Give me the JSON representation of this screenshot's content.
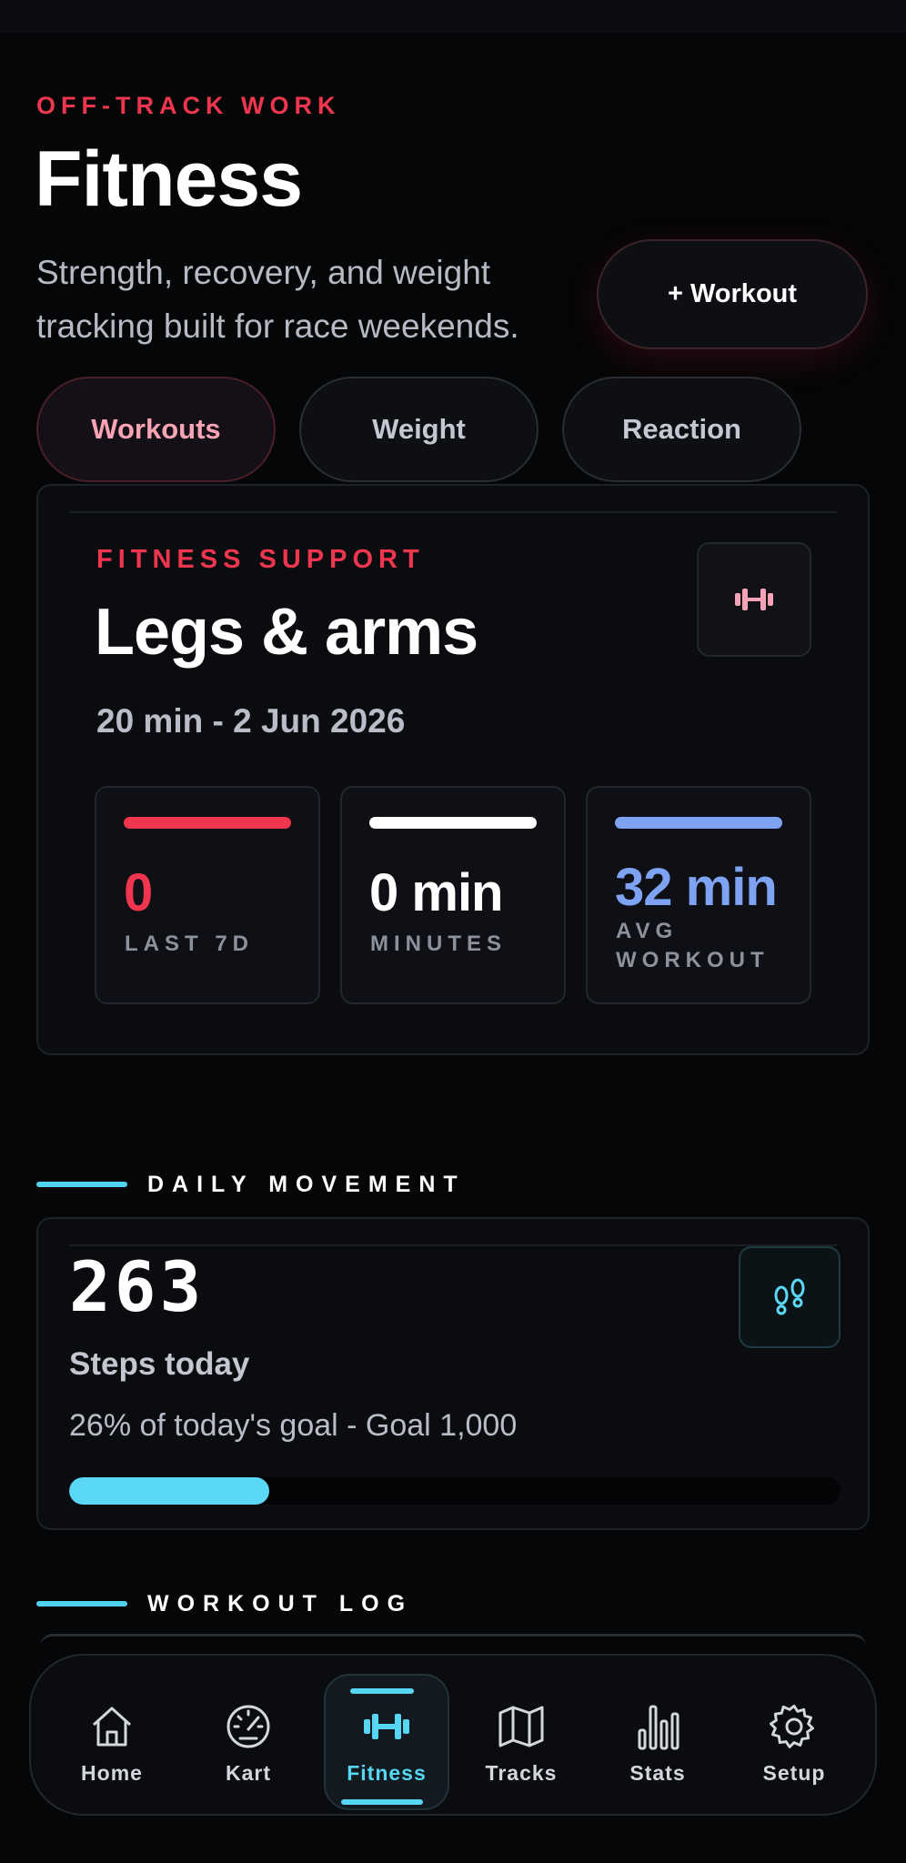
{
  "header": {
    "eyebrow": "OFF-TRACK WORK",
    "title": "Fitness",
    "subtitle": "Strength, recovery, and weight tracking built for race weekends.",
    "add_button_label": "+ Workout"
  },
  "tabs": [
    {
      "label": "Workouts",
      "active": true
    },
    {
      "label": "Weight",
      "active": false
    },
    {
      "label": "Reaction",
      "active": false
    }
  ],
  "fitness_card": {
    "eyebrow": "FITNESS SUPPORT",
    "title": "Legs & arms",
    "subtitle": "20 min - 2 Jun 2026",
    "icon": "dumbbell-icon",
    "stats": [
      {
        "value": "0",
        "label": "LAST 7D",
        "color": "#f0364e"
      },
      {
        "value": "0 min",
        "label": "MINUTES",
        "color": "#ffffff"
      },
      {
        "value": "32 min",
        "label": "AVG WORKOUT",
        "color": "#7ea3f2"
      }
    ]
  },
  "daily_movement": {
    "section_title": "DAILY MOVEMENT",
    "steps": "263",
    "steps_label": "Steps today",
    "goal_text": "26% of today's goal - Goal 1,000",
    "progress_fraction": 0.26,
    "icon": "footprints-icon"
  },
  "workout_log": {
    "section_title": "WORKOUT LOG"
  },
  "nav": [
    {
      "label": "Home",
      "icon": "home-icon",
      "active": false
    },
    {
      "label": "Kart",
      "icon": "speedometer-icon",
      "active": false
    },
    {
      "label": "Fitness",
      "icon": "dumbbell-icon",
      "active": true
    },
    {
      "label": "Tracks",
      "icon": "map-icon",
      "active": false
    },
    {
      "label": "Stats",
      "icon": "bar-chart-icon",
      "active": false
    },
    {
      "label": "Setup",
      "icon": "gear-icon",
      "active": false
    }
  ],
  "colors": {
    "accent_red": "#f0364e",
    "accent_cyan": "#56d6f2",
    "accent_blue": "#7ea3f2",
    "background": "#050607"
  }
}
